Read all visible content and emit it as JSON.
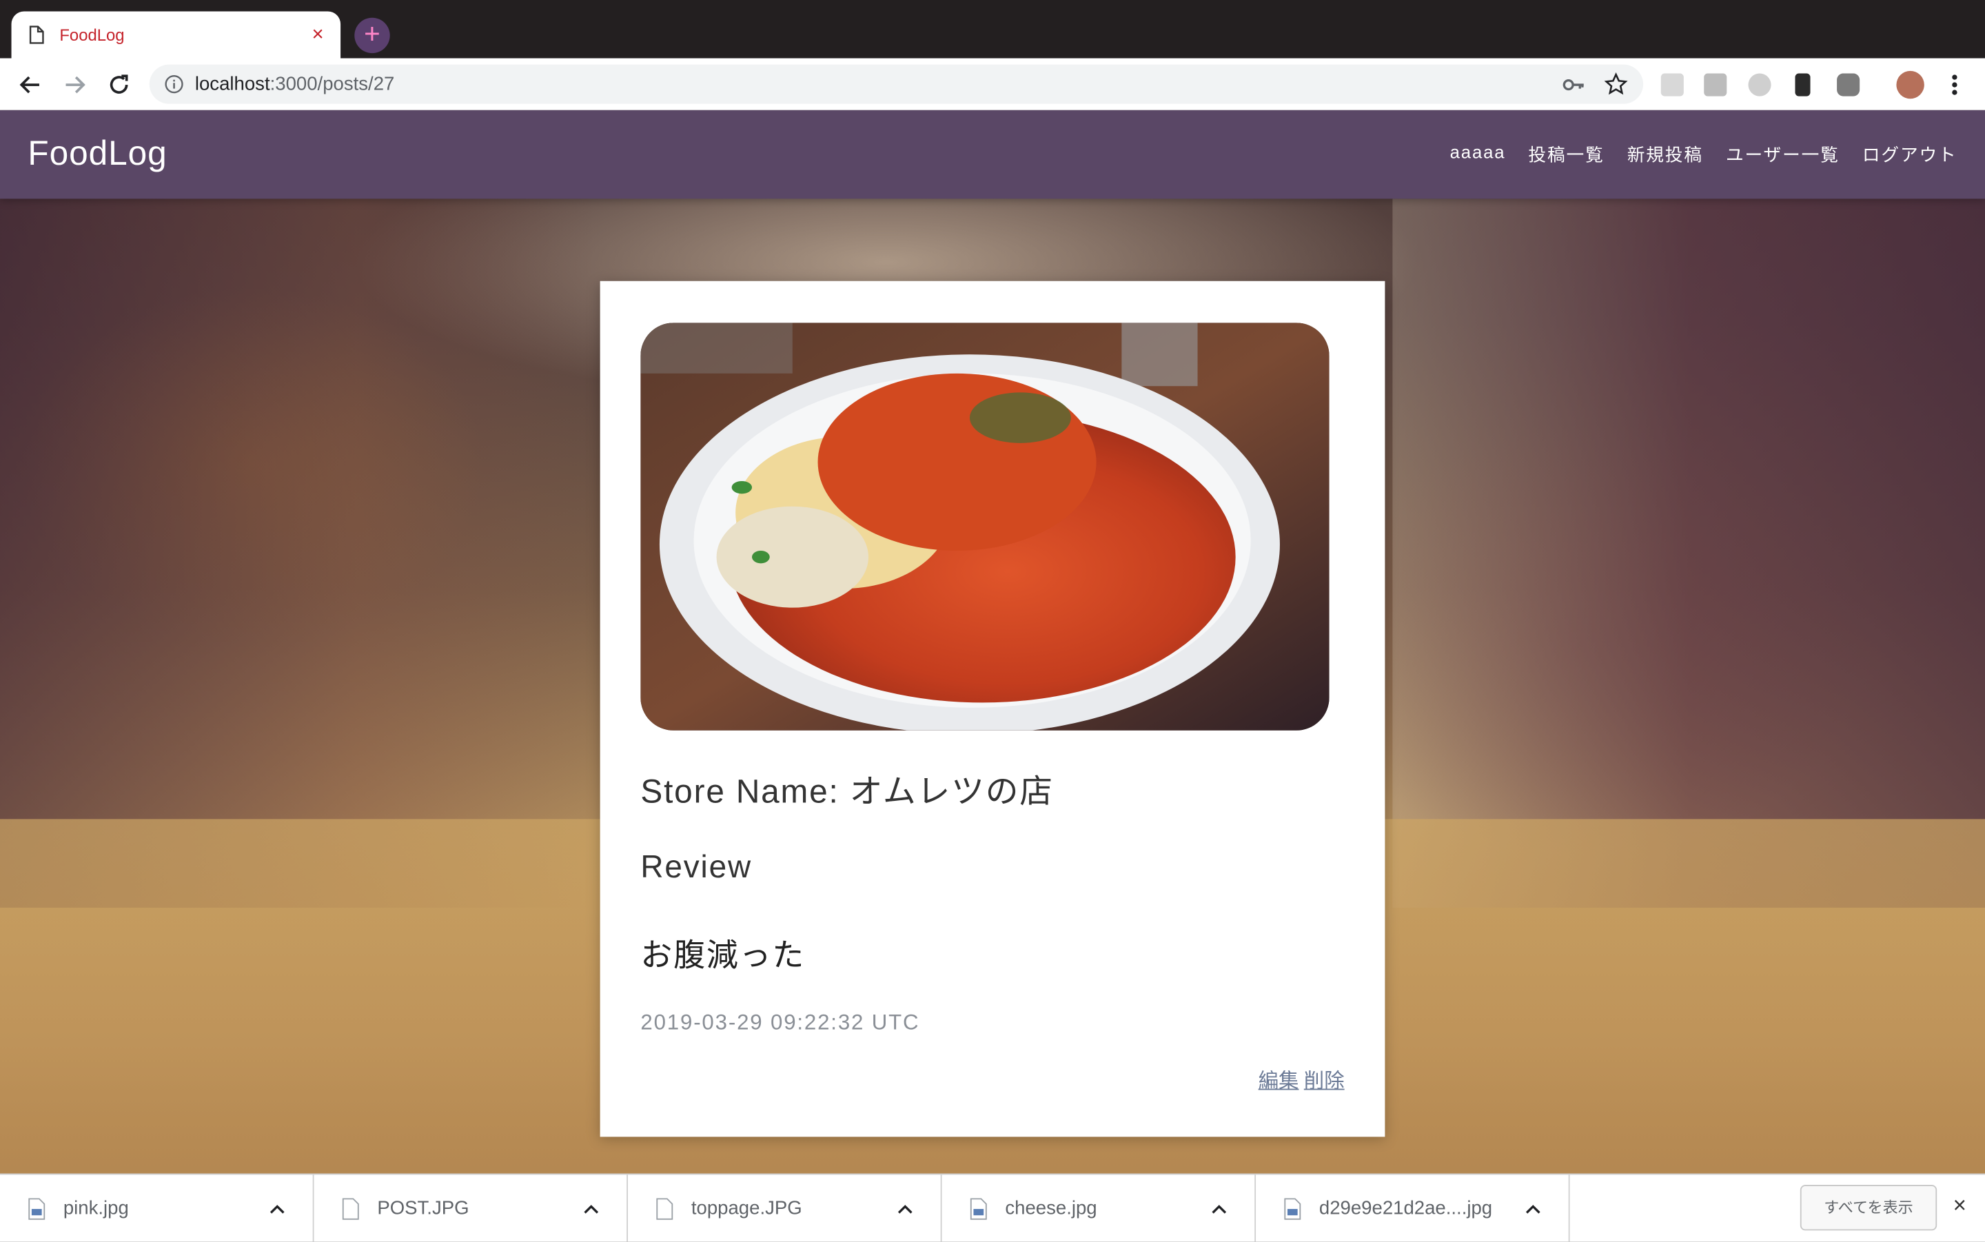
{
  "browser": {
    "tab_title": "FoodLog",
    "tab_close": "×",
    "new_tab": "+",
    "url_host": "localhost",
    "url_path": ":3000/posts/27"
  },
  "site": {
    "brand": "FoodLog",
    "nav": [
      {
        "label": "aaaaa"
      },
      {
        "label": "投稿一覧"
      },
      {
        "label": "新規投稿"
      },
      {
        "label": "ユーザー一覧"
      },
      {
        "label": "ログアウト"
      }
    ]
  },
  "post": {
    "store_line": "Store Name: オムレツの店",
    "review_heading": "Review",
    "review_body": "お腹減った",
    "timestamp": "2019-03-29 09:22:32 UTC",
    "edit_label": "編集",
    "delete_label": "削除"
  },
  "downloads": {
    "items": [
      {
        "name": "pink.jpg",
        "icon": "image-file-icon"
      },
      {
        "name": "POST.JPG",
        "icon": "blank-file-icon"
      },
      {
        "name": "toppage.JPG",
        "icon": "blank-file-icon"
      },
      {
        "name": "cheese.jpg",
        "icon": "image-file-icon"
      },
      {
        "name": "d29e9e21d2ae....jpg",
        "icon": "image-file-icon"
      }
    ],
    "show_all": "すべてを表示",
    "close": "×"
  },
  "colors": {
    "header": "#5a4766",
    "tab_accent": "#c5232b",
    "link": "#6b7a96"
  }
}
